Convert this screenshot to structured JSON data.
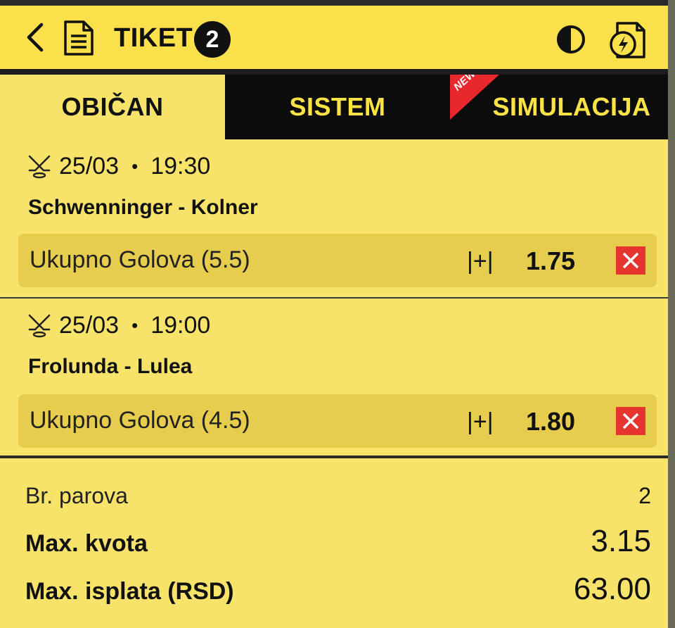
{
  "header": {
    "title": "TIKET",
    "badge_count": "2",
    "icons": [
      "back-icon",
      "document-icon",
      "contrast-icon",
      "quick-ticket-icon"
    ]
  },
  "tabs": [
    {
      "label": "OBIČAN",
      "active": true
    },
    {
      "label": "SISTEM",
      "active": false
    },
    {
      "label": "SIMULACIJA",
      "active": false,
      "ribbon": "NEW!"
    }
  ],
  "matches": [
    {
      "date": "25/03",
      "sep": "•",
      "time": "19:30",
      "teams": "Schwenninger - Kolner",
      "bet": "Ukupno Golova (5.5)",
      "mark": "|+|",
      "odd": "1.75"
    },
    {
      "date": "25/03",
      "sep": "•",
      "time": "19:00",
      "teams": "Frolunda - Lulea",
      "bet": "Ukupno Golova (4.5)",
      "mark": "|+|",
      "odd": "1.80"
    }
  ],
  "summary": {
    "pairs_label": "Br. parova",
    "pairs_value": "2",
    "max_odd_label": "Max. kvota",
    "max_odd_value": "3.15",
    "max_payout_label": "Max. isplata (RSD)",
    "max_payout_value": "63.00"
  },
  "colors": {
    "background": "#f7e36a",
    "header": "#fae04a",
    "dark": "#0c0c0c",
    "accent_text": "#fbe245",
    "bet_box": "#e6cd4e",
    "remove": "#e8342f",
    "ribbon": "#e8282c"
  }
}
